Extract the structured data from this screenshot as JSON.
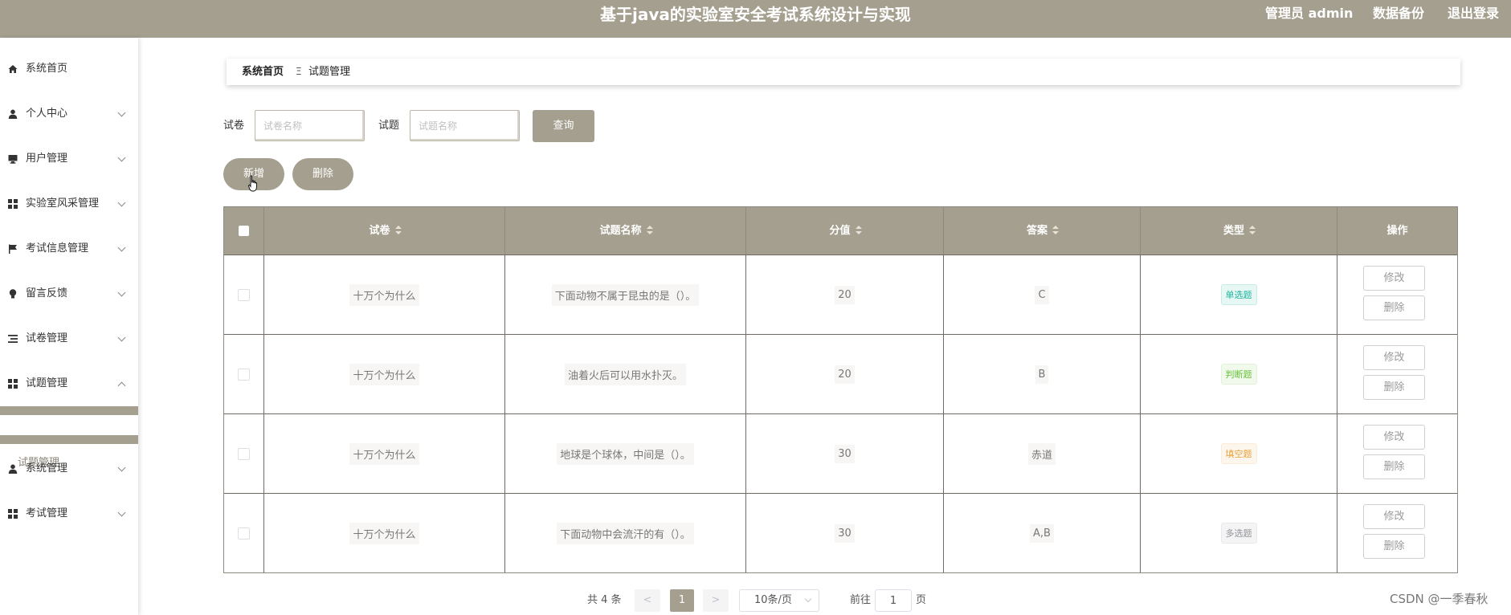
{
  "header": {
    "title": "基于java的实验室安全考试系统设计与实现",
    "admin": "管理员 admin",
    "backup": "数据备份",
    "logout": "退出登录"
  },
  "sidebar": {
    "items": [
      {
        "label": "系统首页",
        "icon": "home-icon"
      },
      {
        "label": "个人中心",
        "icon": "person-icon"
      },
      {
        "label": "用户管理",
        "icon": "monitor-icon"
      },
      {
        "label": "实验室风采管理",
        "icon": "grid-icon"
      },
      {
        "label": "考试信息管理",
        "icon": "flag-icon"
      },
      {
        "label": "留言反馈",
        "icon": "bulb-icon"
      },
      {
        "label": "试卷管理",
        "icon": "list-icon"
      },
      {
        "label": "试题管理",
        "icon": "grid-icon"
      },
      {
        "label": "系统管理",
        "icon": "person-icon"
      },
      {
        "label": "考试管理",
        "icon": "grid-icon"
      }
    ],
    "subitem": "试题管理"
  },
  "breadcrumb": {
    "home": "系统首页",
    "sep": "Ξ",
    "current": "试题管理"
  },
  "search": {
    "paper_label": "试卷",
    "paper_placeholder": "试卷名称",
    "question_label": "试题",
    "question_placeholder": "试题名称",
    "query_button": "查询"
  },
  "actions": {
    "add": "新增",
    "delete": "删除"
  },
  "table": {
    "columns": [
      "试卷",
      "试题名称",
      "分值",
      "答案",
      "类型",
      "操作"
    ],
    "rows": [
      {
        "paper": "十万个为什么",
        "question": "下面动物不属于昆虫的是（）。",
        "score": "20",
        "answer": "C",
        "type": "单选题",
        "type_style": "single"
      },
      {
        "paper": "十万个为什么",
        "question": "油着火后可以用水扑灭。",
        "score": "20",
        "answer": "B",
        "type": "判断题",
        "type_style": "judge"
      },
      {
        "paper": "十万个为什么",
        "question": "地球是个球体，中间是（）。",
        "score": "30",
        "answer": "赤道",
        "type": "填空题",
        "type_style": "fill"
      },
      {
        "paper": "十万个为什么",
        "question": "下面动物中会流汗的有（）。",
        "score": "30",
        "answer": "A,B",
        "type": "多选题",
        "type_style": "multi"
      }
    ],
    "edit_label": "修改",
    "delete_label": "删除"
  },
  "pagination": {
    "total": "共 4 条",
    "prev": "<",
    "current_page": "1",
    "next": ">",
    "page_size": "10条/页",
    "goto": "前往",
    "goto_value": "1",
    "unit": "页"
  },
  "watermark": "CSDN @一季春秋",
  "colors": {
    "accent": "#a59f8f"
  }
}
